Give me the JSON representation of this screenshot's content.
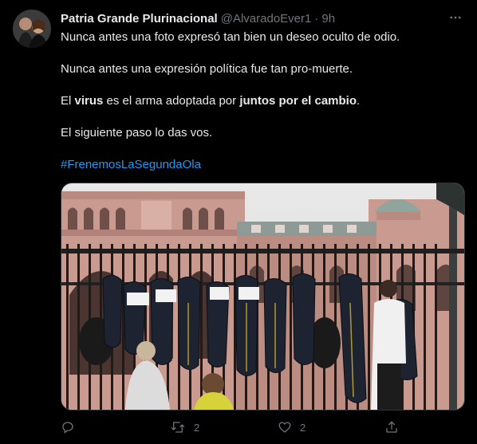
{
  "author": {
    "display_name": "Patria Grande Plurinacional",
    "handle": "@AlvaradoEver1",
    "separator": "·",
    "timestamp": "9h"
  },
  "tweet": {
    "line1": "Nunca antes una foto expresó tan bien un deseo oculto de odio.",
    "line2": "Nunca antes una expresión política fue tan pro-muerte.",
    "line3_pre": "El ",
    "line3_bold1": "virus",
    "line3_mid": " es el arma adoptada por ",
    "line3_bold2": "juntos por el cambio",
    "line3_post": ".",
    "line4": "El siguiente paso lo das vos.",
    "hashtag": "#FrenemosLaSegundaOla"
  },
  "actions": {
    "reply_count": "",
    "retweet_count": "2",
    "like_count": "2"
  },
  "icons": {
    "more": "more-icon",
    "reply": "reply-icon",
    "retweet": "retweet-icon",
    "like": "heart-icon",
    "share": "share-icon"
  },
  "colors": {
    "background": "#000000",
    "text": "#e7e9ea",
    "muted": "#71767b",
    "link": "#1d9bf0",
    "border": "#2f3336"
  }
}
